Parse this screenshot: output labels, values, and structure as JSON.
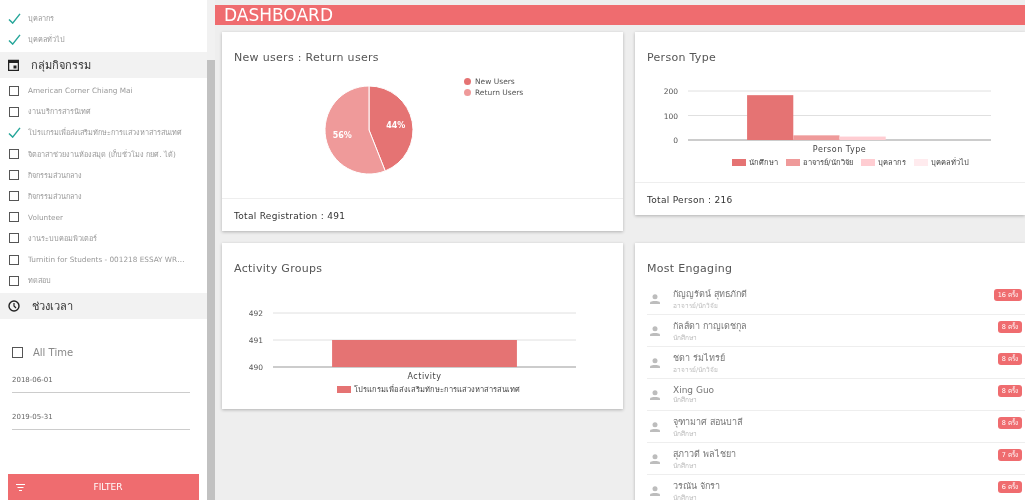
{
  "sidebar": {
    "person_types": [
      {
        "label": "บุคลากร",
        "checked": true
      },
      {
        "label": "บุคคลทั่วไป",
        "checked": true
      }
    ],
    "activity_group": {
      "title": "กลุ่มกิจกรรม",
      "items": [
        {
          "label": "American Corner Chiang Mai",
          "checked": false
        },
        {
          "label": "งานบริการสารนิเทศ",
          "checked": false
        },
        {
          "label": "โปรแกรมเพื่อส่งเสริมทักษะการแสวงหาสารสนเทศ",
          "checked": true
        },
        {
          "label": "จิตอาสาช่วยงานห้องสมุด (เก็บชั่วโมง กยศ. ได้)",
          "checked": false
        },
        {
          "label": "กิจกรรมส่วนกลาง",
          "checked": false
        },
        {
          "label": "กิจกรรมส่วนกลาง",
          "checked": false
        },
        {
          "label": "Volunteer",
          "checked": false
        },
        {
          "label": "งานระบบคอมพิวเตอร์",
          "checked": false
        },
        {
          "label": "Turnitin for Students - 001218 ESSAY WR…",
          "checked": false
        },
        {
          "label": "ทดสอบ",
          "checked": false
        }
      ]
    },
    "time_range": {
      "title": "ช่วงเวลา",
      "all_time": {
        "label": "All Time",
        "checked": false
      },
      "start_date": {
        "value": "2018-06-01"
      },
      "end_date": {
        "value": "2019-05-31"
      }
    },
    "filter_button": "FILTER"
  },
  "header": {
    "title": "DASHBOARD"
  },
  "users_card": {
    "title": "New users : Return users",
    "footer": "Total Registration : 491",
    "chart_data": {
      "type": "pie",
      "categories": [
        "New Users",
        "Return Users"
      ],
      "values": [
        44,
        56
      ],
      "colors": [
        "#e57373",
        "#ef9a9a"
      ],
      "value_labels": [
        "44%",
        "56%"
      ],
      "legend": "right"
    }
  },
  "person_card": {
    "title": "Person Type",
    "footer": "Total Person : 216",
    "chart_data": {
      "type": "bar",
      "categories": [
        null
      ],
      "xlabel": "Person Type",
      "legend": "bottom",
      "ylim": [
        0,
        200
      ],
      "yticks": [
        0,
        100,
        200
      ],
      "series": [
        {
          "name": "นักศึกษา",
          "color": "#e57373",
          "values": [
            183
          ]
        },
        {
          "name": "อาจารย์/นักวิจัย",
          "color": "#ef9a9a",
          "values": [
            19
          ]
        },
        {
          "name": "บุคลากร",
          "color": "#ffcdd2",
          "values": [
            14
          ]
        },
        {
          "name": "บุคคลทั่วไป",
          "color": "#ffebee",
          "values": [
            0
          ]
        }
      ]
    }
  },
  "activity_card": {
    "title": "Activity Groups",
    "chart_data": {
      "type": "bar",
      "categories": [
        null
      ],
      "xlabel": "Activity",
      "legend": "bottom",
      "ylim": [
        490,
        492
      ],
      "yticks": [
        490,
        491,
        492
      ],
      "series": [
        {
          "name": "โปรแกรมเพื่อส่งเสริมทักษะการแสวงหาสารสนเทศ",
          "color": "#e57373",
          "values": [
            491
          ]
        }
      ]
    }
  },
  "engaging_card": {
    "title": "Most Engaging",
    "people": [
      {
        "name": "กัญญรัตน์ สุทธภักดี",
        "role": "อาจารย์/นักวิจัย",
        "count": "16 ครั้ง"
      },
      {
        "name": "กัลส์ดา กาญเดชกุล",
        "role": "นักศึกษา",
        "count": "8 ครั้ง"
      },
      {
        "name": "ชดา ร่มไทรย์",
        "role": "อาจารย์/นักวิจัย",
        "count": "8 ครั้ง"
      },
      {
        "name": "Xing Guo",
        "role": "นักศึกษา",
        "count": "8 ครั้ง"
      },
      {
        "name": "จุฑามาศ สอนบาลี",
        "role": "นักศึกษา",
        "count": "8 ครั้ง"
      },
      {
        "name": "สุภาวดี พลไชยา",
        "role": "นักศึกษา",
        "count": "7 ครั้ง"
      },
      {
        "name": "วรณัน จักรา",
        "role": "นักศึกษา",
        "count": "6 ครั้ง"
      }
    ]
  }
}
